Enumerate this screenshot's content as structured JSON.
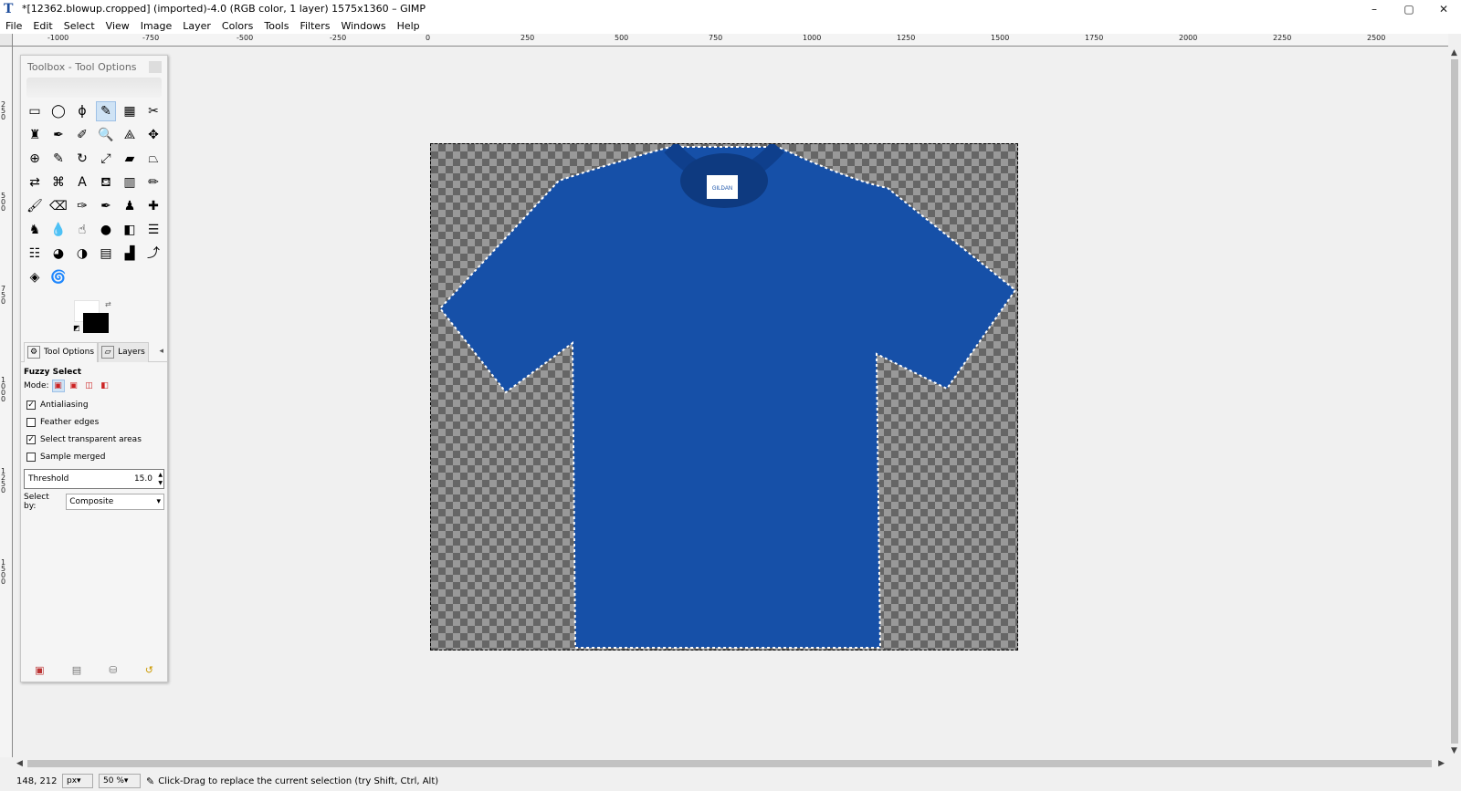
{
  "window": {
    "title": "*[12362.blowup.cropped] (imported)-4.0 (RGB color, 1 layer) 1575x1360 – GIMP",
    "app_icon": "gimp-icon",
    "minimize": "–",
    "restore": "▢",
    "close": "✕"
  },
  "menubar": {
    "items": [
      "File",
      "Edit",
      "Select",
      "View",
      "Image",
      "Layer",
      "Colors",
      "Tools",
      "Filters",
      "Windows",
      "Help"
    ]
  },
  "rulers": {
    "horizontal": [
      "-1000",
      "-750",
      "-500",
      "-250",
      "0",
      "250",
      "500",
      "750",
      "1000",
      "1250",
      "1500",
      "1750",
      "2000",
      "2250",
      "2500"
    ],
    "vertical": [
      "250",
      "500",
      "750",
      "1000",
      "1250",
      "1500"
    ]
  },
  "toolbox": {
    "title": "Toolbox - Tool Options",
    "tools": [
      {
        "name": "rect-select-icon",
        "glyph": "▭"
      },
      {
        "name": "ellipse-select-icon",
        "glyph": "◯"
      },
      {
        "name": "free-select-icon",
        "glyph": "ϕ"
      },
      {
        "name": "fuzzy-select-icon",
        "glyph": "✎",
        "active": true
      },
      {
        "name": "select-by-color-icon",
        "glyph": "▦"
      },
      {
        "name": "scissors-icon",
        "glyph": "✂"
      },
      {
        "name": "foreground-select-icon",
        "glyph": "♜"
      },
      {
        "name": "paths-icon",
        "glyph": "✒"
      },
      {
        "name": "color-picker-icon",
        "glyph": "✐"
      },
      {
        "name": "zoom-icon",
        "glyph": "🔍"
      },
      {
        "name": "measure-icon",
        "glyph": "⟁"
      },
      {
        "name": "move-icon",
        "glyph": "✥"
      },
      {
        "name": "align-icon",
        "glyph": "⊕"
      },
      {
        "name": "transform-icon",
        "glyph": "✎"
      },
      {
        "name": "rotate-icon",
        "glyph": "↻"
      },
      {
        "name": "scale-icon",
        "glyph": "⤢"
      },
      {
        "name": "shear-icon",
        "glyph": "▰"
      },
      {
        "name": "perspective-icon",
        "glyph": "⏢"
      },
      {
        "name": "flip-icon",
        "glyph": "⇄"
      },
      {
        "name": "cage-icon",
        "glyph": "⌘"
      },
      {
        "name": "text-icon",
        "glyph": "A"
      },
      {
        "name": "bucket-fill-icon",
        "glyph": "⛾"
      },
      {
        "name": "gradient-icon",
        "glyph": "▥"
      },
      {
        "name": "pencil-icon",
        "glyph": "✏"
      },
      {
        "name": "paintbrush-icon",
        "glyph": "🖌"
      },
      {
        "name": "eraser-icon",
        "glyph": "⌫"
      },
      {
        "name": "airbrush-icon",
        "glyph": "✑"
      },
      {
        "name": "ink-icon",
        "glyph": "✒"
      },
      {
        "name": "clone-icon",
        "glyph": "♟"
      },
      {
        "name": "heal-icon",
        "glyph": "✚"
      },
      {
        "name": "perspective-clone-icon",
        "glyph": "♞"
      },
      {
        "name": "blur-icon",
        "glyph": "💧"
      },
      {
        "name": "smudge-icon",
        "glyph": "☝"
      },
      {
        "name": "dodge-burn-icon",
        "glyph": "●"
      },
      {
        "name": "desaturate-icon",
        "glyph": "◧"
      },
      {
        "name": "color-balance-icon",
        "glyph": "☰"
      },
      {
        "name": "hue-saturation-icon",
        "glyph": "☷"
      },
      {
        "name": "colorize-icon",
        "glyph": "◕"
      },
      {
        "name": "brightness-contrast-icon",
        "glyph": "◑"
      },
      {
        "name": "threshold-icon",
        "glyph": "▤"
      },
      {
        "name": "levels-icon",
        "glyph": "▟"
      },
      {
        "name": "curves-icon",
        "glyph": "⤴"
      },
      {
        "name": "posterize-icon",
        "glyph": "◈"
      },
      {
        "name": "spiral-icon",
        "glyph": "🌀"
      }
    ],
    "color_swap_icon": "swap-colors-icon",
    "color_reset_icon": "reset-colors-icon"
  },
  "tabs": {
    "tool_options": "Tool Options",
    "layers": "Layers",
    "menu_icon": "◂"
  },
  "tool_options": {
    "title": "Fuzzy Select",
    "mode_label": "Mode:",
    "antialiasing": {
      "label": "Antialiasing",
      "checked": true
    },
    "feather_edges": {
      "label": "Feather edges",
      "checked": false
    },
    "select_transparent": {
      "label": "Select transparent areas",
      "checked": true
    },
    "sample_merged": {
      "label": "Sample merged",
      "checked": false
    },
    "threshold": {
      "label": "Threshold",
      "value": "15.0"
    },
    "select_by": {
      "label": "Select by:",
      "value": "Composite"
    }
  },
  "dock_bottom": {
    "icons": [
      "save-preset-icon",
      "restore-preset-icon",
      "delete-preset-icon",
      "reset-icon"
    ]
  },
  "image": {
    "label_brand": "GILDAN",
    "shirt_color": "#1650A8"
  },
  "status": {
    "coords": "148, 212",
    "unit": "px",
    "zoom": "50 %",
    "message": "Click-Drag to replace the current selection (try Shift, Ctrl, Alt)"
  }
}
